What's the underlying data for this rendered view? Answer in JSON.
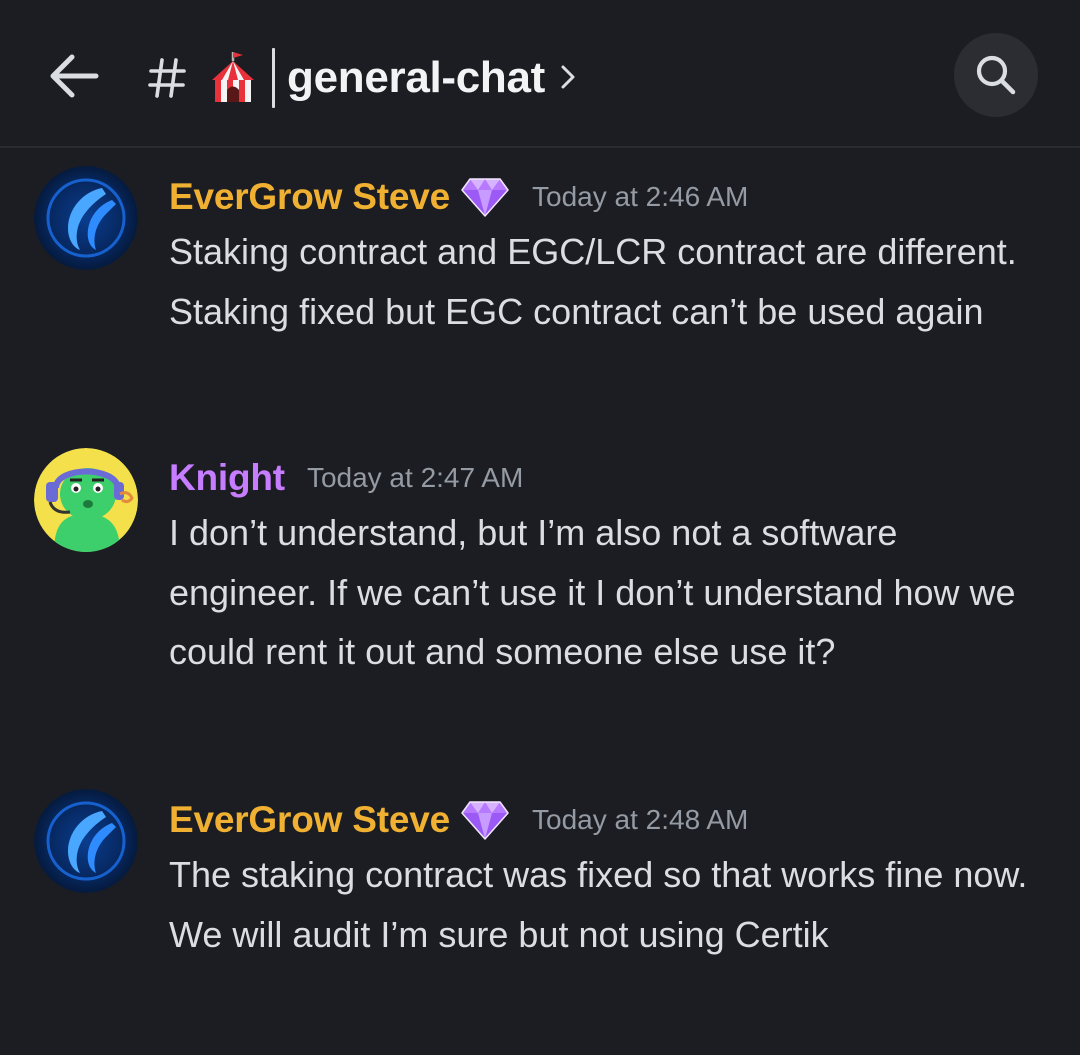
{
  "header": {
    "channel_name": "general-chat",
    "icons": {
      "back": "arrow-left-icon",
      "hash": "hash-icon",
      "channel_emoji": "circus-tent-icon",
      "chevron": "chevron-right-icon",
      "search": "search-icon"
    }
  },
  "colors": {
    "background": "#1c1d22",
    "evergrow_name": "#f0b132",
    "knight_name": "#c77dff",
    "timestamp": "#949ba4",
    "message_text": "#dbdee1"
  },
  "messages": [
    {
      "author": "EverGrow Steve",
      "badge": "gem-icon",
      "timestamp": "Today at 2:46 AM",
      "text": "Staking contract and EGC/LCR contract are different. Staking fixed but EGC contract can’t be used again"
    },
    {
      "author": "Knight",
      "timestamp": "Today at 2:47 AM",
      "text": "I don’t understand, but I’m also not a software engineer.  If we can’t use it I don’t understand how we could rent it out and someone else use it?"
    },
    {
      "author": "EverGrow Steve",
      "badge": "gem-icon",
      "timestamp": "Today at 2:48 AM",
      "text": "The staking contract was fixed so that works fine now. We will audit I’m sure but not using Certik"
    }
  ]
}
